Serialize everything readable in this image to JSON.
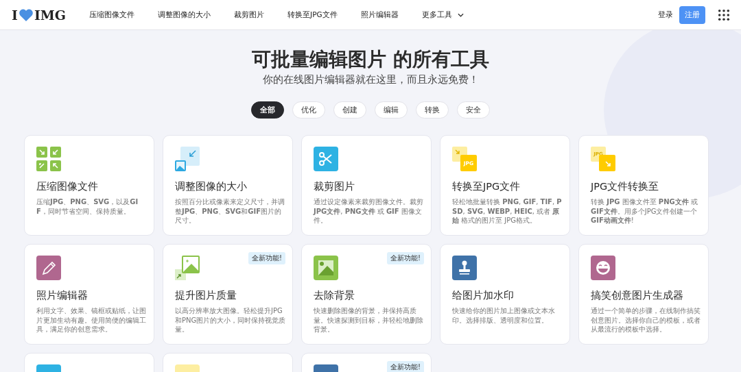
{
  "header": {
    "logo_left": "I",
    "logo_right": "IMG",
    "nav": [
      {
        "label": "压缩图像文件",
        "dropdown": false
      },
      {
        "label": "调整图像的大小",
        "dropdown": false
      },
      {
        "label": "裁剪图片",
        "dropdown": false
      },
      {
        "label": "转换至JPG文件",
        "dropdown": false
      },
      {
        "label": "照片编辑器",
        "dropdown": false
      },
      {
        "label": "更多工具",
        "dropdown": true
      }
    ],
    "login": "登录",
    "signup": "注册"
  },
  "hero": {
    "title": "可批量编辑图片 的所有工具",
    "subtitle": "你的在线图片编辑器就在这里，而且永远免费！"
  },
  "filters": [
    {
      "label": "全部",
      "selected": true
    },
    {
      "label": "优化",
      "selected": false
    },
    {
      "label": "创建",
      "selected": false
    },
    {
      "label": "编辑",
      "selected": false
    },
    {
      "label": "转换",
      "selected": false
    },
    {
      "label": "安全",
      "selected": false
    }
  ],
  "cards": [
    {
      "kind": "compress",
      "title": "压缩图像文件",
      "description": "压缩**JPG**、**PNG**、**SVG**，以及**GIF**，同时节省空间、保持质量。"
    },
    {
      "kind": "resize",
      "title": "调整图像的大小",
      "description": "按照百分比或像素来定义尺寸，并调整**JPG**、**PNG**、**SVG**和**GIF**图片的尺寸。"
    },
    {
      "kind": "crop",
      "title": "裁剪图片",
      "description": "通过设定像素来裁剪图像文件。裁剪**JPG文件**, **PNG文件** 或 **GIF** 图像文件。"
    },
    {
      "kind": "to-jpg",
      "icon_text": "JPG",
      "title": "转换至JPG文件",
      "description": "轻松地批量转换 **PNG**, **GIF**, **TIF**, **PSD**, **SVG**, **WEBP**, **HEIC**, 或者 **原始** 格式的图片至 JPG格式。"
    },
    {
      "kind": "from-jpg",
      "icon_text": "JPG",
      "title": "JPG文件转换至",
      "description": "转换 **JPG** 图像文件至 **PNG文件** 或 **GIF文件**。用多个JPG文件创建一个**GIF动画文件**!"
    },
    {
      "kind": "edit",
      "title": "照片编辑器",
      "description": "利用文字、效果、镜框或贴纸，让图片更加生动有趣。使用简便的编辑工具，满足你的创意需求。"
    },
    {
      "kind": "upscale",
      "badge": "全新功能!",
      "title": "提升图片质量",
      "description": "以高分辨率放大图像。轻松提升JPG和PNG图片的大小，同时保持视觉质量。"
    },
    {
      "kind": "remove-bg",
      "badge": "全新功能!",
      "title": "去除背景",
      "description": "快速删除图像的背景，并保持高质量。快速探测到目标，并轻松地删除背景。"
    },
    {
      "kind": "watermark",
      "title": "给图片加水印",
      "description": "快速给你的图片加上图像或文本水印。选择排版、透明度和位置。"
    },
    {
      "kind": "meme",
      "title": "搞笑创意图片生成器",
      "description": "通过一个简单的步骤，在线制作搞笑创意图片。选择你自己的模板，或者从最流行的模板中选择。"
    },
    {
      "kind": "cyan"
    },
    {
      "kind": "pale"
    },
    {
      "kind": "navy",
      "badge": "全新功能!"
    }
  ]
}
